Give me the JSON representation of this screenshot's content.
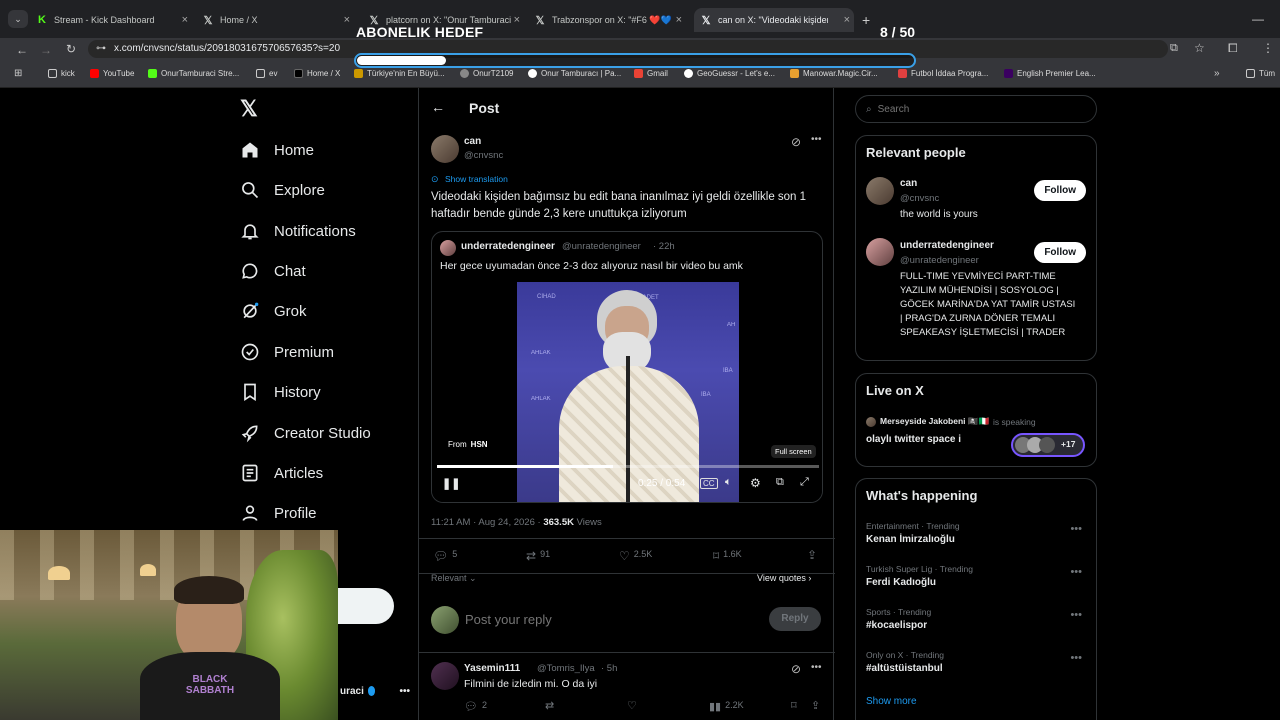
{
  "browser": {
    "tabs": [
      {
        "title": "Stream - Kick Dashboard",
        "icon": "kick-icon"
      },
      {
        "title": "Home / X",
        "icon": "x-icon"
      },
      {
        "title": "platcorn on X: \"Onur Tamburaci",
        "icon": "x-icon"
      },
      {
        "title": "Trabzonspor on X: \"#F6 ❤️💙",
        "icon": "x-icon"
      },
      {
        "title": "can on X: \"Videodaki kişiden",
        "icon": "x-icon"
      }
    ],
    "url": "x.com/cnvsnc/status/2091803167570657635?s=20",
    "bookmarks": [
      "kick",
      "YouTube",
      "OnurTamburaci Stre...",
      "ev",
      "Home / X",
      "Türkiye'nin En Büyü...",
      "OnurT2109",
      "Onur Tamburacı | Pa...",
      "Gmail",
      "GeoGuessr - Let's e...",
      "Manowar.Magic.Cir...",
      "Futbol İddaa Progra...",
      "English Premier Lea...",
      "Tüm"
    ]
  },
  "overlay": {
    "goal_label": "ABONELIK HEDEF",
    "goal_count": "8 / 50",
    "goal_progress": 0.16
  },
  "nav": {
    "items": [
      "Home",
      "Explore",
      "Notifications",
      "Chat",
      "Grok",
      "Premium",
      "History",
      "Creator Studio",
      "Articles",
      "Profile"
    ],
    "account_name_fragment": "uraci"
  },
  "post": {
    "header_title": "Post",
    "author_name": "can",
    "author_handle": "@cnvsnc",
    "show_translation": "Show translation",
    "text": "Videodaki kişiden bağımsız bu edit bana inanılmaz iyi geldi özellikle son 1 haftadır bende günde 2,3 kere unuttukça izliyorum",
    "quote": {
      "author_name": "underratedengineer",
      "author_handle": "@unratedengineer",
      "time": "· 22h",
      "text": "Her gece uyumadan önce 2-3 doz alıyoruz nasıl bir video bu amk",
      "video_source_prefix": "From",
      "video_source": "HSN",
      "fullscreen_label": "Full screen",
      "time_display": "0:25 / 0:54",
      "video_progress": 0.46,
      "wall_words": [
        "CİHAD",
        "İBADET",
        "AH",
        "AHLAK",
        "İBA",
        "AHLAK",
        "İBA"
      ]
    },
    "timestamp": "11:21 AM · Aug 24, 2026 · ",
    "views_count": "363.5K",
    "views_label": " Views",
    "stats": {
      "replies": "5",
      "reposts": "91",
      "likes": "2.5K",
      "bookmarks": "1.6K"
    },
    "sort_label": "Relevant",
    "view_quotes": "View quotes",
    "reply_placeholder": "Post your reply",
    "reply_button": "Reply"
  },
  "reply": {
    "author_name": "Yasemin111",
    "author_handle": "@Tomris_Ilya",
    "time": "· 5h",
    "text": "Filmini de izledin mi. O da iyi",
    "stats": {
      "replies": "2",
      "views": "2.2K"
    }
  },
  "sidebar": {
    "search_placeholder": "Search",
    "relevant_title": "Relevant people",
    "people": [
      {
        "name": "can",
        "handle": "@cnvsnc",
        "bio": "the world is yours",
        "button": "Follow"
      },
      {
        "name": "underratedengineer",
        "handle": "@unratedengineer",
        "bio": "FULL-TIME YEVMİYECİ PART-TIME YAZILIM MÜHENDİSİ | SOSYOLOG | GÖCEK MARİNA'DA YAT TAMİR USTASI | PRAG'DA ZURNA DÖNER TEMALI SPEAKEASY İŞLETMECİSİ | TRADER",
        "button": "Follow"
      }
    ],
    "live_title": "Live on X",
    "live": {
      "host": "Merseyside Jakobeni 🏴‍☠️🇮🇹",
      "status": " is speaking",
      "title": "olaylı twitter space i",
      "count": "+17"
    },
    "trending_title": "What's happening",
    "trends": [
      {
        "meta": "Entertainment · Trending",
        "name": "Kenan İmirzalıoğlu"
      },
      {
        "meta": "Turkish Super Lig · Trending",
        "name": "Ferdi Kadıoğlu"
      },
      {
        "meta": "Sports · Trending",
        "name": "#kocaelispor"
      },
      {
        "meta": "Only on X · Trending",
        "name": "#altüstüistanbul"
      }
    ],
    "show_more": "Show more"
  },
  "webcam": {
    "shirt_text": "BLACK SABBATH"
  }
}
